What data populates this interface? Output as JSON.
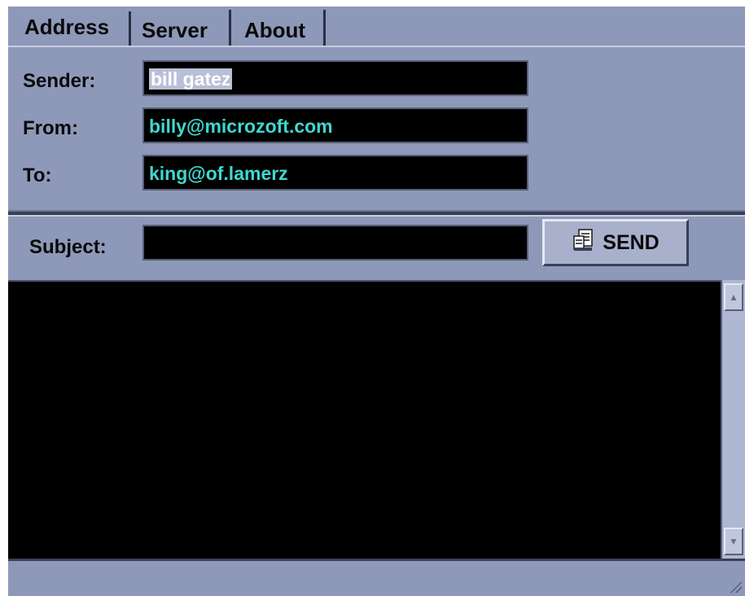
{
  "tabs": [
    {
      "label": "Address",
      "active": true
    },
    {
      "label": "Server",
      "active": false
    },
    {
      "label": "About",
      "active": false
    }
  ],
  "address": {
    "sender": {
      "label": "Sender:",
      "value": "bill gatez"
    },
    "from": {
      "label": "From:",
      "value": "billy@microzoft.com"
    },
    "to": {
      "label": "To:",
      "value": "king@of.lamerz"
    }
  },
  "subject": {
    "label": "Subject:",
    "value": ""
  },
  "send_button": {
    "label": "SEND",
    "icon": "document-icon"
  },
  "message_body": {
    "value": ""
  },
  "colors": {
    "panel": "#8e98b8",
    "field_bg": "#000000",
    "field_text": "#3fd8d0",
    "selection": "#b9bfd6"
  }
}
